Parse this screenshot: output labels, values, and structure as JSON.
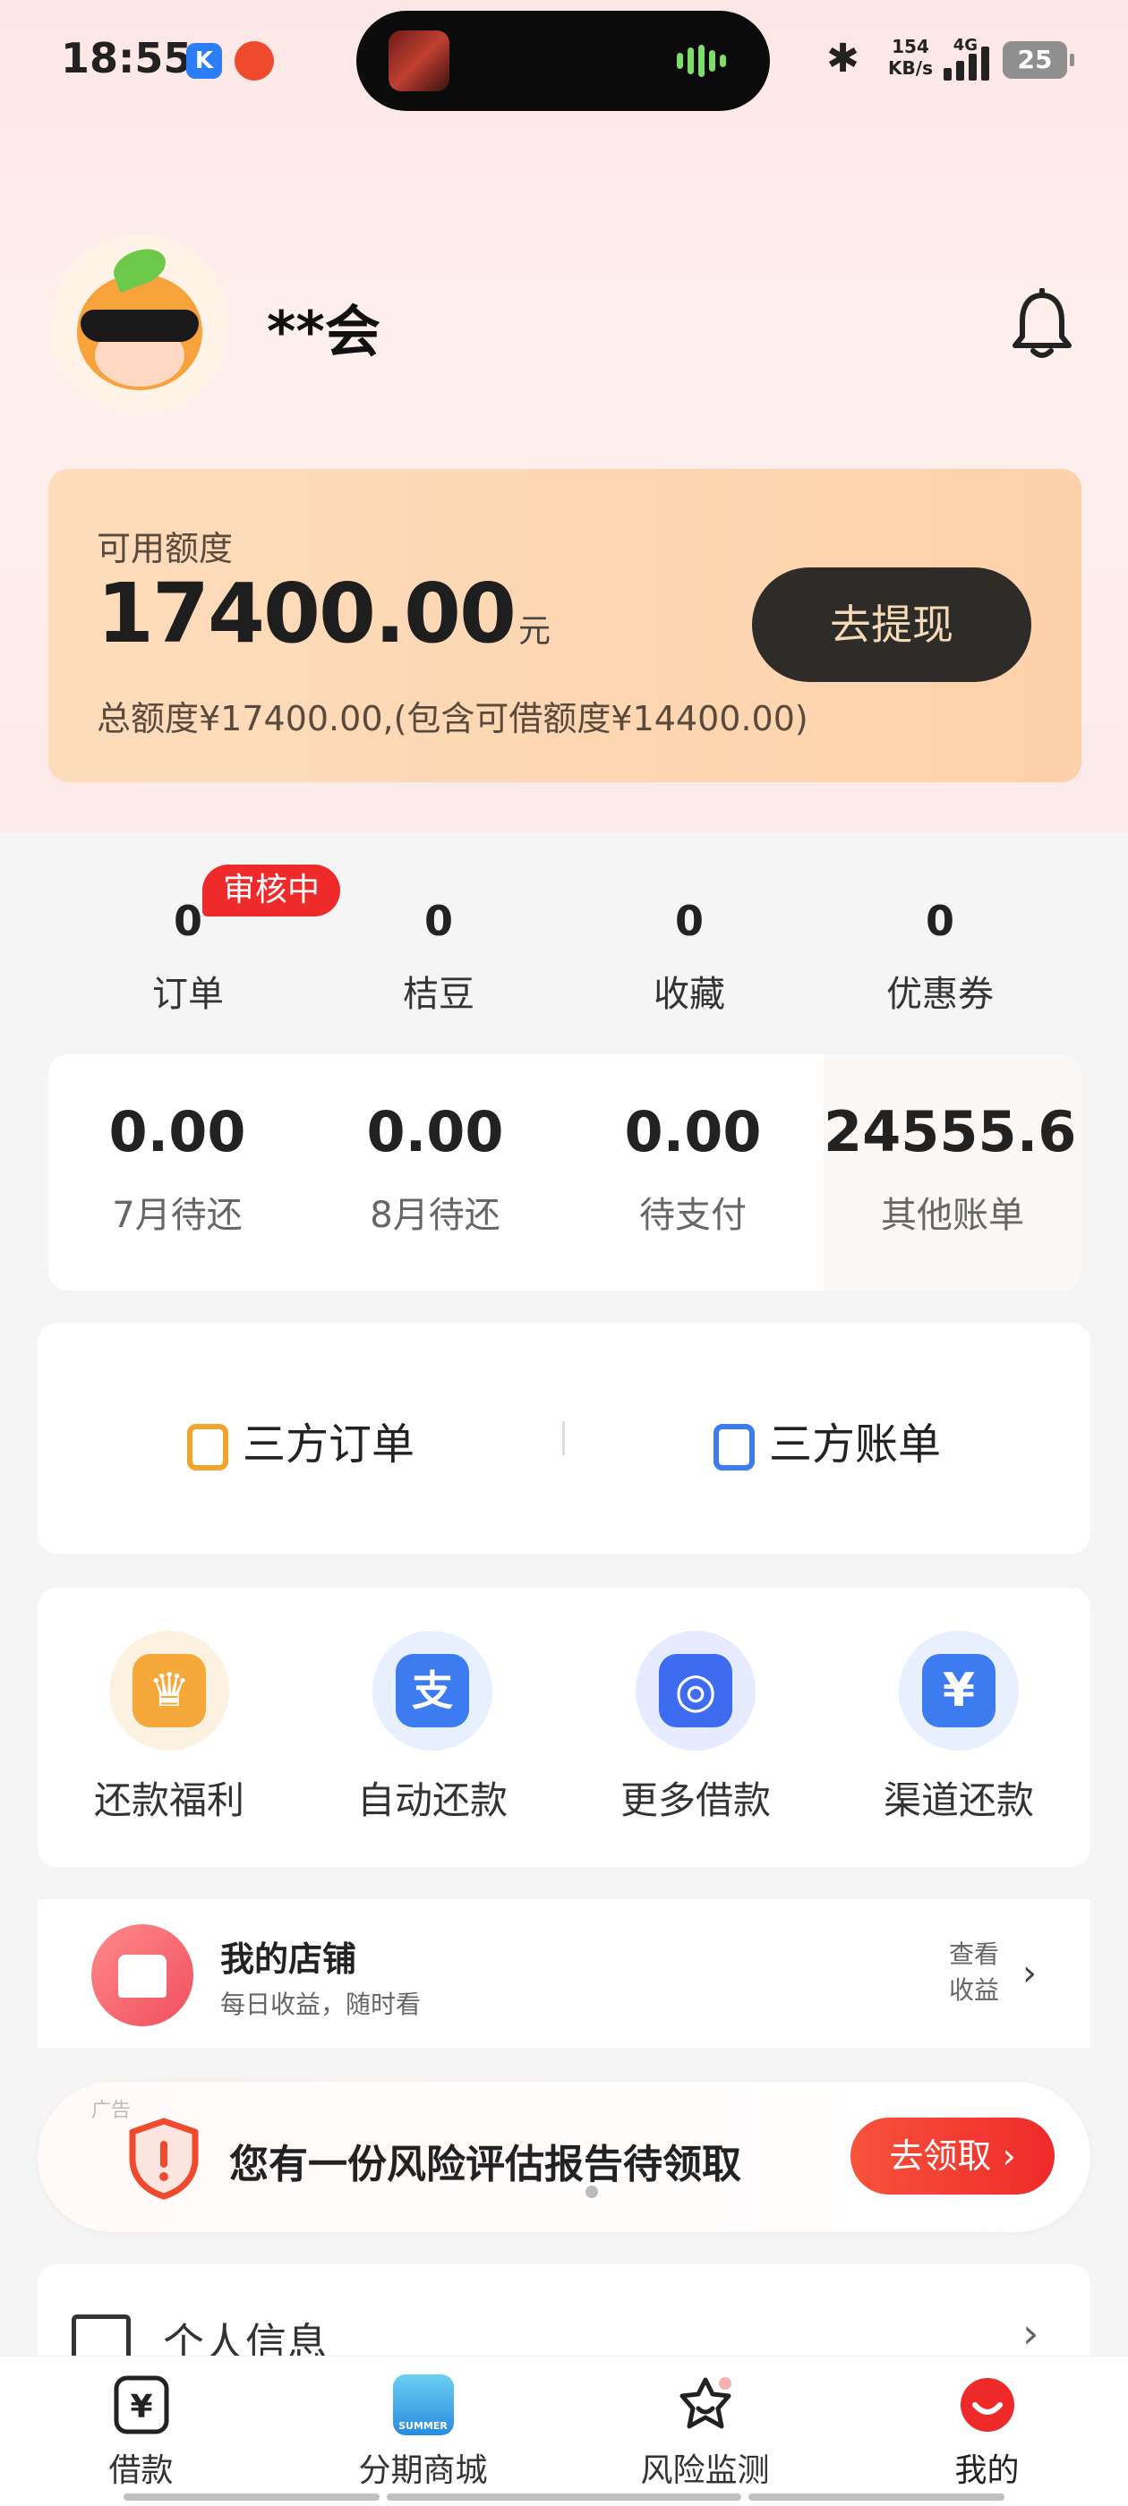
{
  "status_bar": {
    "time": "18:55",
    "app_badge": "K",
    "net_speed_value": "154",
    "net_speed_unit": "KB/s",
    "network": "4G",
    "battery": "25"
  },
  "profile": {
    "username": "**会"
  },
  "credit": {
    "label": "可用额度",
    "amount": "17400.00",
    "unit": "元",
    "total_text": "总额度¥17400.00,(包含可借额度¥14400.00)",
    "withdraw_label": "去提现"
  },
  "stats": {
    "badge": "审核中",
    "items": [
      {
        "value": "0",
        "label": "订单"
      },
      {
        "value": "0",
        "label": "桔豆"
      },
      {
        "value": "0",
        "label": "收藏"
      },
      {
        "value": "0",
        "label": "优惠券"
      }
    ]
  },
  "bills": [
    {
      "value": "0.00",
      "label": "7月待还"
    },
    {
      "value": "0.00",
      "label": "8月待还"
    },
    {
      "value": "0.00",
      "label": "待支付"
    },
    {
      "value": "24555.61",
      "label": "其他账单"
    }
  ],
  "third_party": {
    "orders_label": "三方订单",
    "bills_label": "三方账单"
  },
  "services": [
    {
      "label": "还款福利",
      "icon": "crown-icon",
      "color": "#f6a93a",
      "glyph": "♛"
    },
    {
      "label": "自动还款",
      "icon": "alipay-icon",
      "color": "#3d7bf0",
      "glyph": "支"
    },
    {
      "label": "更多借款",
      "icon": "search-icon",
      "color": "#3d6cf0",
      "glyph": "◎"
    },
    {
      "label": "渠道还款",
      "icon": "yen-icon",
      "color": "#3d7bf0",
      "glyph": "¥"
    }
  ],
  "shop": {
    "title": "我的店铺",
    "subtitle": "每日收益，随时看",
    "more_label_1": "查看",
    "more_label_2": "收益"
  },
  "ad": {
    "tag": "广告",
    "text": "您有一份风险评估报告待领取",
    "button": "去领取 ›"
  },
  "personal": {
    "label": "个人信息"
  },
  "bottom_nav": [
    {
      "label": "借款",
      "icon": "loan-icon"
    },
    {
      "label": "分期商城",
      "icon": "mall-icon",
      "icon_text": "SUMMER"
    },
    {
      "label": "风险监测",
      "icon": "risk-monitor-icon"
    },
    {
      "label": "我的",
      "icon": "profile-icon"
    }
  ]
}
